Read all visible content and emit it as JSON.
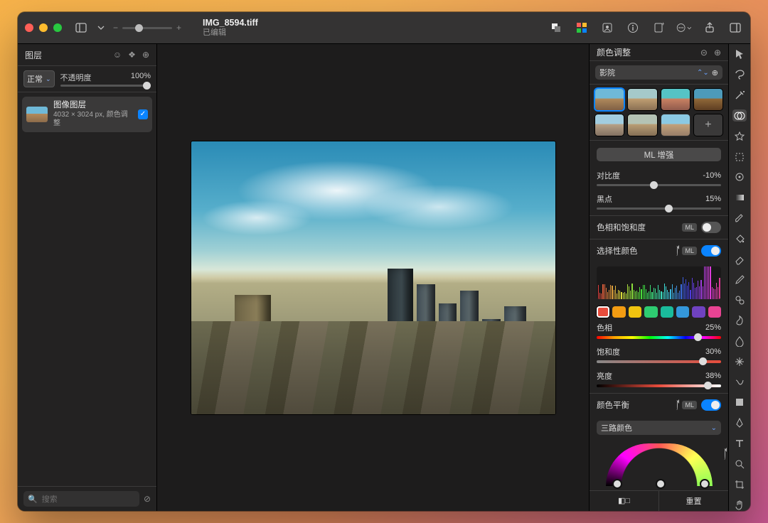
{
  "title": {
    "file": "IMG_8594.tiff",
    "status": "已编辑"
  },
  "left": {
    "header": "图层",
    "blend_mode": "正常",
    "opacity_label": "不透明度",
    "opacity_value": "100%",
    "layer": {
      "name": "图像图层",
      "meta": "4032 × 3024 px, 颜色调整"
    },
    "search_placeholder": "搜索"
  },
  "right": {
    "header": "颜色调整",
    "preset": "影院",
    "ml_enhance": "ML 增强",
    "params": {
      "contrast": {
        "label": "对比度",
        "value": "-10%",
        "pos": 43
      },
      "black": {
        "label": "黑点",
        "value": "15%",
        "pos": 55
      }
    },
    "groups": {
      "huesat": {
        "label": "色相和饱和度",
        "ml": "ML",
        "on": false
      },
      "selcolor": {
        "label": "选择性颜色",
        "ml": "ML",
        "on": true
      },
      "balance": {
        "label": "颜色平衡",
        "ml": "ML",
        "on": true
      }
    },
    "hsb": {
      "hue": {
        "label": "色相",
        "value": "25%",
        "pos": 78
      },
      "sat": {
        "label": "饱和度",
        "value": "30%",
        "pos": 82
      },
      "lum": {
        "label": "亮度",
        "value": "38%",
        "pos": 86
      }
    },
    "swatch_colors": [
      "#e74c3c",
      "#f39c12",
      "#f1c40f",
      "#2ecc71",
      "#1abc9c",
      "#3498db",
      "#6f42c1",
      "#e84393"
    ],
    "tri_dropdown": "三路颜色",
    "footer": {
      "reset": "重置"
    }
  },
  "rail_tools": [
    "arrow",
    "lasso",
    "wand",
    "color-adjust",
    "star",
    "marquee",
    "crop-rotate",
    "gradient",
    "brush",
    "bucket",
    "eraser",
    "pencil",
    "clone",
    "smudge",
    "blur",
    "sparkle",
    "warp",
    "shape",
    "pen",
    "type",
    "zoom",
    "crop",
    "hand"
  ]
}
